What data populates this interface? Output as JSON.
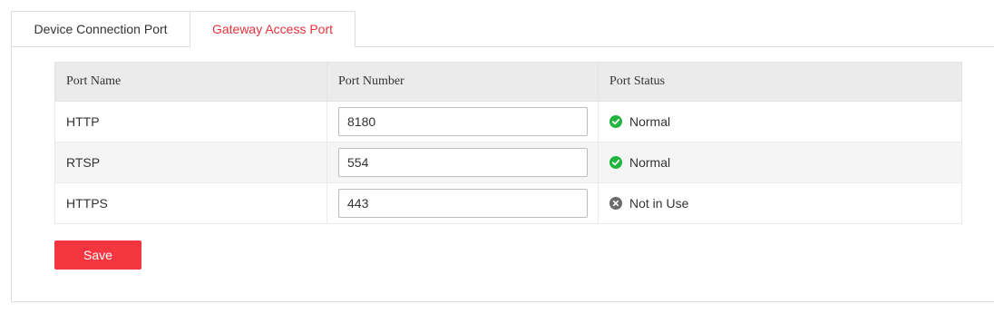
{
  "tabs": [
    {
      "label": "Device Connection Port",
      "active": false
    },
    {
      "label": "Gateway Access Port",
      "active": true
    }
  ],
  "table": {
    "headers": {
      "port_name": "Port Name",
      "port_number": "Port Number",
      "port_status": "Port Status"
    },
    "rows": [
      {
        "name": "HTTP",
        "number": "8180",
        "status": "Normal",
        "status_icon": "check-circle-icon"
      },
      {
        "name": "RTSP",
        "number": "554",
        "status": "Normal",
        "status_icon": "check-circle-icon"
      },
      {
        "name": "HTTPS",
        "number": "443",
        "status": "Not in Use",
        "status_icon": "x-circle-icon"
      }
    ]
  },
  "actions": {
    "save_label": "Save"
  },
  "colors": {
    "accent": "#e5323c",
    "save_button": "#f53641",
    "status_normal": "#21b540",
    "status_unused": "#6b6b6b"
  }
}
